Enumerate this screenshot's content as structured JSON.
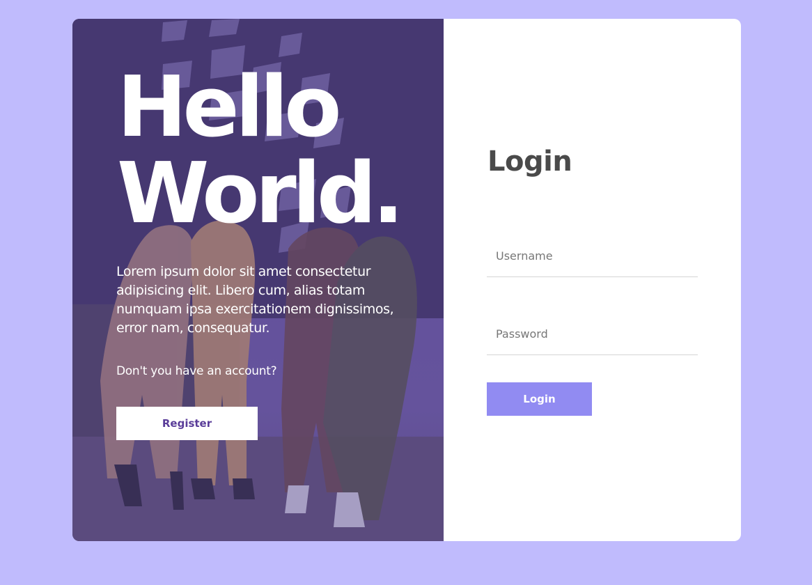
{
  "hero": {
    "title_line1": "Hello",
    "title_line2": "World.",
    "description": "Lorem ipsum dolor sit amet consectetur adipisicing elit. Libero cum, alias totam numquam ipsa exercitationem dignissimos, error nam, consequatur.",
    "question": "Don't you have an account?",
    "register_label": "Register"
  },
  "login": {
    "title": "Login",
    "username_placeholder": "Username",
    "password_placeholder": "Password",
    "submit_label": "Login"
  },
  "colors": {
    "page_background": "#c0bbfd",
    "accent": "#918bf2",
    "register_text": "#5a3d99",
    "heading": "#4a4a4a"
  }
}
